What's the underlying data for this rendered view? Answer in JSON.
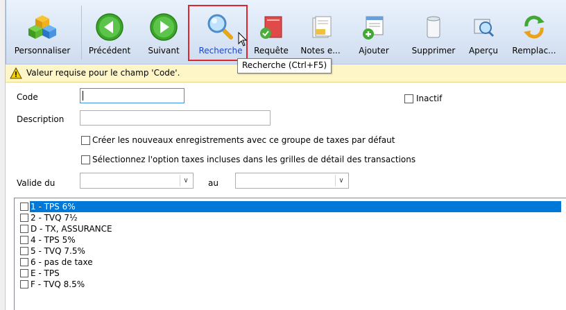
{
  "toolbar": {
    "buttons": [
      {
        "label": "Personnaliser"
      },
      {
        "label": "Précédent"
      },
      {
        "label": "Suivant"
      },
      {
        "label": "Recherche"
      },
      {
        "label": "Requête"
      },
      {
        "label": "Notes e..."
      },
      {
        "label": "Ajouter"
      },
      {
        "label": "Supprimer"
      },
      {
        "label": "Aperçu"
      },
      {
        "label": "Remplac..."
      }
    ],
    "tooltip": "Recherche (Ctrl+F5)"
  },
  "warning": {
    "text": "Valeur requise pour le champ 'Code'."
  },
  "form": {
    "code_label": "Code",
    "code_value": "",
    "description_label": "Description",
    "description_value": "",
    "inactif_label": "Inactif",
    "default_group_label": "Créer les nouveaux enregistrements avec ce groupe de taxes par défaut",
    "taxes_incluses_label": "Sélectionnez l'option taxes incluses dans les grilles de détail des transactions",
    "valide_du_label": "Valide du",
    "au_label": "au",
    "valide_du_value": "",
    "au_value": ""
  },
  "tax_list": [
    {
      "label": "1 - TPS 6%",
      "selected": true
    },
    {
      "label": "2 - TVQ 7½",
      "selected": false
    },
    {
      "label": "D - TX, ASSURANCE",
      "selected": false
    },
    {
      "label": "4 - TPS 5%",
      "selected": false
    },
    {
      "label": "5 - TVQ 7.5%",
      "selected": false
    },
    {
      "label": "6 - pas de taxe",
      "selected": false
    },
    {
      "label": "E - TPS",
      "selected": false
    },
    {
      "label": "F - TVQ 8.5%",
      "selected": false
    }
  ],
  "colors": {
    "selection": "#0078d7",
    "highlight": "#e0242c",
    "warning_bg": "#fff6c8"
  }
}
